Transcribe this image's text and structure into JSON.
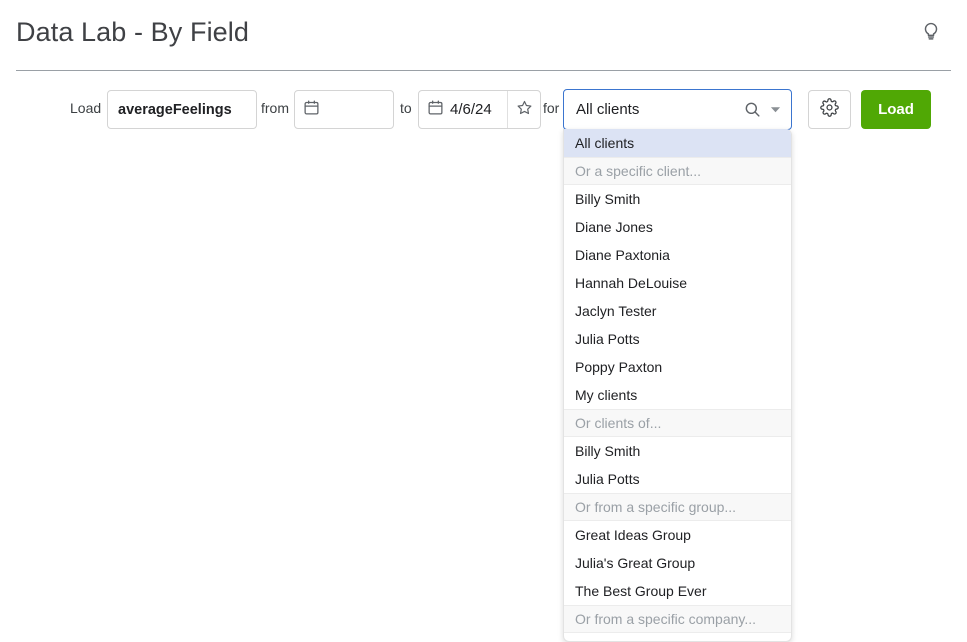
{
  "header": {
    "title": "Data Lab - By Field",
    "action_icon": "lightbulb-icon"
  },
  "toolbar": {
    "load_label": "Load",
    "dataset_value": "averageFeelings",
    "dataset_placeholder": "",
    "from_label": "from",
    "from_value": "",
    "from_placeholder": "",
    "to_label": "to",
    "to_value": "4/6/24",
    "favorite_icon": "star-icon",
    "for_label": "for",
    "settings_icon": "gear-icon",
    "load_button_label": "Load"
  },
  "client_select": {
    "value": "All clients",
    "search_icon": "search-icon",
    "caret_icon": "chevron-down-icon",
    "options": [
      {
        "label": "All clients",
        "type": "option",
        "selected": true
      },
      {
        "label": "Or a specific client...",
        "type": "group-header",
        "selected": false
      },
      {
        "label": "Billy Smith",
        "type": "option",
        "selected": false
      },
      {
        "label": "Diane Jones",
        "type": "option",
        "selected": false
      },
      {
        "label": "Diane Paxtonia",
        "type": "option",
        "selected": false
      },
      {
        "label": "Hannah DeLouise",
        "type": "option",
        "selected": false
      },
      {
        "label": "Jaclyn Tester",
        "type": "option",
        "selected": false
      },
      {
        "label": "Julia Potts",
        "type": "option",
        "selected": false
      },
      {
        "label": "Poppy Paxton",
        "type": "option",
        "selected": false
      },
      {
        "label": "My clients",
        "type": "option",
        "selected": false
      },
      {
        "label": "Or clients of...",
        "type": "group-header",
        "selected": false
      },
      {
        "label": "Billy Smith",
        "type": "option",
        "selected": false
      },
      {
        "label": "Julia Potts",
        "type": "option",
        "selected": false
      },
      {
        "label": "Or from a specific group...",
        "type": "group-header",
        "selected": false
      },
      {
        "label": "Great Ideas Group",
        "type": "option",
        "selected": false
      },
      {
        "label": "Julia's Great Group",
        "type": "option",
        "selected": false
      },
      {
        "label": "The Best Group Ever",
        "type": "option",
        "selected": false
      },
      {
        "label": "Or from a specific company...",
        "type": "group-header",
        "selected": false
      }
    ]
  },
  "colors": {
    "accent_green": "#50a805",
    "focus_blue": "#3b75cf",
    "selected_row": "#dce3f4",
    "group_header_bg": "#f8f8f8"
  }
}
